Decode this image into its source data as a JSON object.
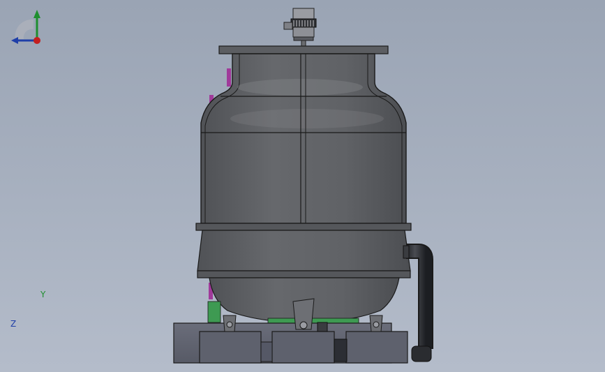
{
  "viewport": {
    "background_top": "#9aa4b4",
    "background_bottom": "#b4bcca",
    "model_color": "#5b5d61",
    "base_color": "#5f6270",
    "pipe_color": "#303236",
    "accent_green": "#3e9a52",
    "accent_magenta": "#a03a9a"
  },
  "triad": {
    "y_label": "Y",
    "z_label": "Z",
    "y_color": "#1f8f2f",
    "z_color": "#1f3fa8",
    "x_color": "#c41f1f"
  }
}
